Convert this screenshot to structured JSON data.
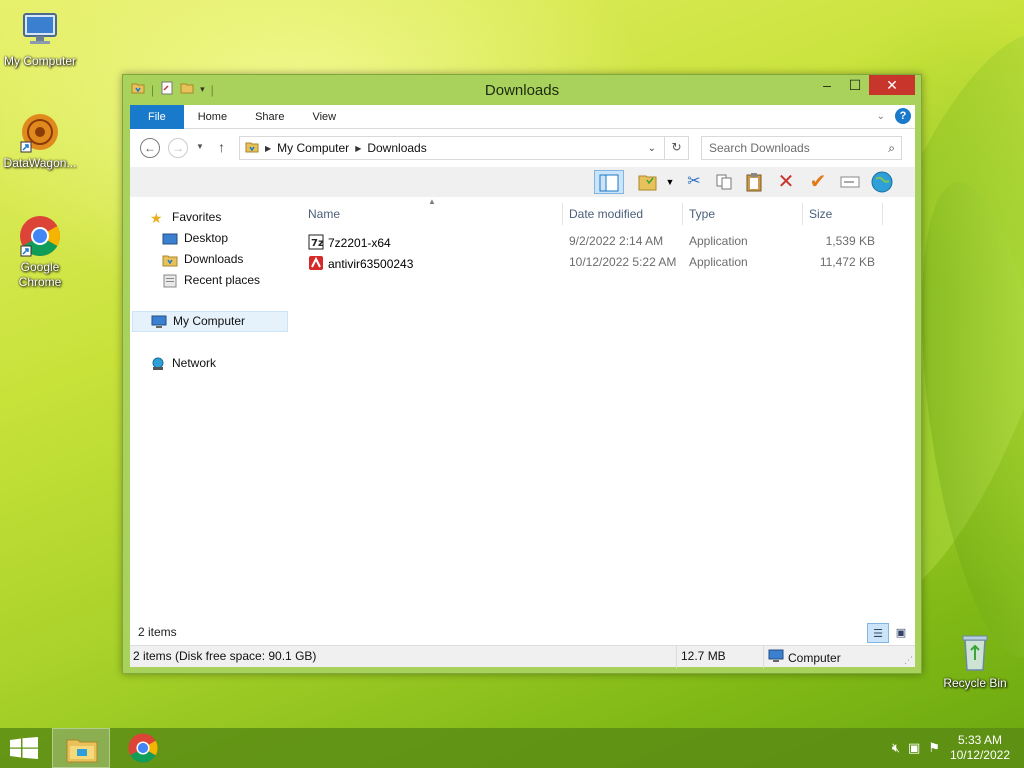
{
  "desktop": {
    "icons": [
      {
        "label": "My Computer",
        "icon": "computer-icon"
      },
      {
        "label": "DataWagon...",
        "icon": "datawagon-icon"
      },
      {
        "label": "Google Chrome",
        "icon": "chrome-icon"
      },
      {
        "label": "Recycle Bin",
        "icon": "recycle-bin-icon"
      }
    ]
  },
  "window": {
    "title": "Downloads",
    "ribbon_tabs": [
      "File",
      "Home",
      "Share",
      "View"
    ],
    "address": {
      "crumbs": [
        "My Computer",
        "Downloads"
      ]
    },
    "search": {
      "placeholder": "Search Downloads"
    },
    "nav_pane": {
      "favorites": "Favorites",
      "favorite_items": [
        "Desktop",
        "Downloads",
        "Recent places"
      ],
      "my_computer": "My Computer",
      "network": "Network"
    },
    "columns": [
      "Name",
      "Date modified",
      "Type",
      "Size"
    ],
    "files": [
      {
        "name": "7z2201-x64",
        "date": "9/2/2022 2:14 AM",
        "type": "Application",
        "size": "1,539 KB",
        "icon": "7zip-icon"
      },
      {
        "name": "antivir63500243",
        "date": "10/12/2022 5:22 AM",
        "type": "Application",
        "size": "11,472 KB",
        "icon": "avira-icon"
      }
    ],
    "item_count": "2 items",
    "status": {
      "items": "2 items (Disk free space: 90.1 GB)",
      "size": "12.7 MB",
      "location": "Computer"
    }
  },
  "taskbar": {
    "time": "5:33 AM",
    "date": "10/12/2022"
  },
  "colors": {
    "accent": "#1979ca",
    "close": "#c7352b",
    "window_frame": "#a9d25c"
  }
}
